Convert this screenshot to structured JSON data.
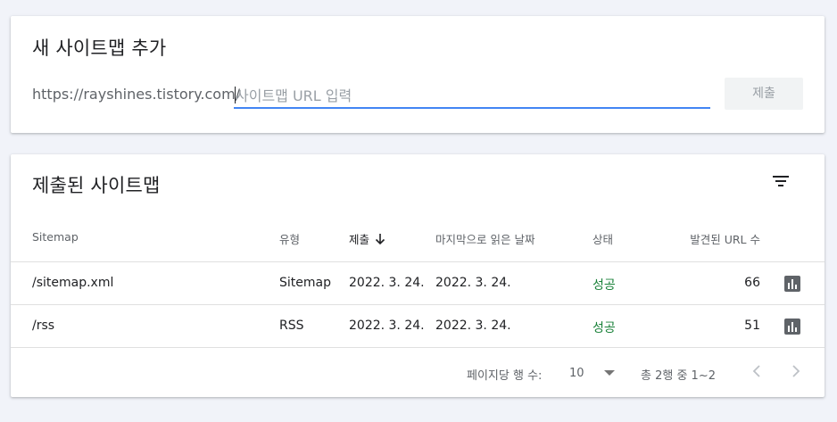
{
  "add_sitemap": {
    "title": "새 사이트맵 추가",
    "url_prefix": "https://rayshines.tistory.com/",
    "input_value": "",
    "input_placeholder": "사이트맵 URL 입력",
    "submit_label": "제출"
  },
  "submitted": {
    "title": "제출된 사이트맵",
    "filter_icon": "filter-icon",
    "columns": {
      "sitemap": "Sitemap",
      "type": "유형",
      "submitted": "제출",
      "last_read": "마지막으로 읽은 날짜",
      "status": "상태",
      "discovered_urls": "발견된 URL 수"
    },
    "rows": [
      {
        "sitemap": "/sitemap.xml",
        "type": "Sitemap",
        "submitted": "2022. 3. 24.",
        "last_read": "2022. 3. 24.",
        "status": "성공",
        "discovered_urls": "66"
      },
      {
        "sitemap": "/rss",
        "type": "RSS",
        "submitted": "2022. 3. 24.",
        "last_read": "2022. 3. 24.",
        "status": "성공",
        "discovered_urls": "51"
      }
    ],
    "pagination": {
      "rows_per_page_label": "페이지당 행 수:",
      "rows_per_page_value": "10",
      "range_label": "총 2행 중 1~2"
    }
  },
  "colors": {
    "background": "#f1f3f9",
    "accent": "#4285f4",
    "success": "#188038",
    "icon": "#5f6368"
  }
}
